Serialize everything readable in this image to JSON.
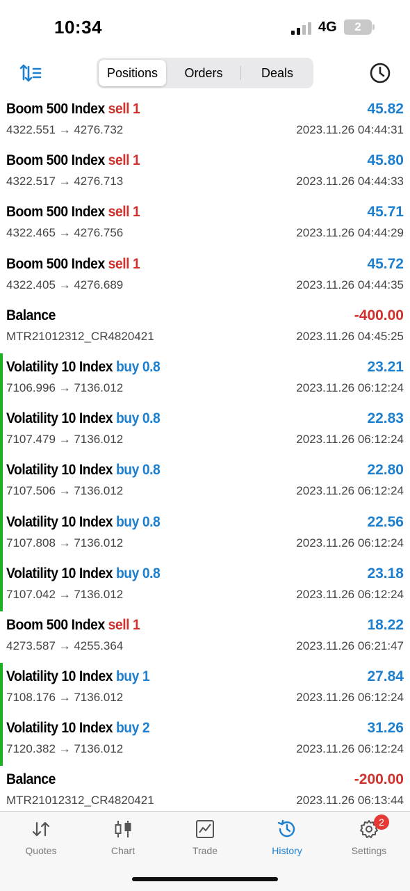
{
  "status": {
    "time": "10:34",
    "network": "4G",
    "battery_text": "2",
    "battery_level": 0.2
  },
  "header": {
    "tabs": [
      {
        "label": "Positions"
      },
      {
        "label": "Orders"
      },
      {
        "label": "Deals"
      }
    ],
    "active_tab": "Positions",
    "icons": {
      "left": "sort-icon",
      "right": "history-clock-icon"
    }
  },
  "rows": [
    {
      "symbol": "Boom 500 Index",
      "side": "sell 1",
      "prices": "4322.551 → 4276.732",
      "profit": "45.82",
      "time": "2023.11.26 04:44:31"
    },
    {
      "symbol": "Boom 500 Index",
      "side": "sell 1",
      "prices": "4322.517 → 4276.713",
      "profit": "45.80",
      "time": "2023.11.26 04:44:33"
    },
    {
      "symbol": "Boom 500 Index",
      "side": "sell 1",
      "prices": "4322.465 → 4276.756",
      "profit": "45.71",
      "time": "2023.11.26 04:44:29"
    },
    {
      "symbol": "Boom 500 Index",
      "side": "sell 1",
      "prices": "4322.405 → 4276.689",
      "profit": "45.72",
      "time": "2023.11.26 04:44:35"
    },
    {
      "symbol": "Balance",
      "side": "",
      "prices": "MTR21012312_CR4820421",
      "profit": "-400.00",
      "time": "2023.11.26 04:45:25"
    },
    {
      "symbol": "Volatility 10 Index",
      "side": "buy 0.8",
      "prices": "7106.996 → 7136.012",
      "profit": "23.21",
      "time": "2023.11.26 06:12:24"
    },
    {
      "symbol": "Volatility 10 Index",
      "side": "buy 0.8",
      "prices": "7107.479 → 7136.012",
      "profit": "22.83",
      "time": "2023.11.26 06:12:24"
    },
    {
      "symbol": "Volatility 10 Index",
      "side": "buy 0.8",
      "prices": "7107.506 → 7136.012",
      "profit": "22.80",
      "time": "2023.11.26 06:12:24"
    },
    {
      "symbol": "Volatility 10 Index",
      "side": "buy 0.8",
      "prices": "7107.808 → 7136.012",
      "profit": "22.56",
      "time": "2023.11.26 06:12:24"
    },
    {
      "symbol": "Volatility 10 Index",
      "side": "buy 0.8",
      "prices": "7107.042 → 7136.012",
      "profit": "23.18",
      "time": "2023.11.26 06:12:24"
    },
    {
      "symbol": "Boom 500 Index",
      "side": "sell 1",
      "prices": "4273.587 → 4255.364",
      "profit": "18.22",
      "time": "2023.11.26 06:21:47"
    },
    {
      "symbol": "Volatility 10 Index",
      "side": "buy 1",
      "prices": "7108.176 → 7136.012",
      "profit": "27.84",
      "time": "2023.11.26 06:12:24"
    },
    {
      "symbol": "Volatility 10 Index",
      "side": "buy 2",
      "prices": "7120.382 → 7136.012",
      "profit": "31.26",
      "time": "2023.11.26 06:12:24"
    },
    {
      "symbol": "Balance",
      "side": "",
      "prices": "MTR21012312_CR4820421",
      "profit": "-200.00",
      "time": "2023.11.26 06:13:44"
    }
  ],
  "colors": {
    "sell": "#d0312d",
    "buy": "#1d7fce",
    "positive": "#1d7fce",
    "negative": "#d0312d",
    "buy_indicator": "#1fb021",
    "active_tab": "#1d7fce"
  },
  "tabbar": {
    "items": [
      {
        "label": "Quotes",
        "icon": "quotes-arrows-icon"
      },
      {
        "label": "Chart",
        "icon": "candlestick-chart-icon"
      },
      {
        "label": "Trade",
        "icon": "trade-chart-icon"
      },
      {
        "label": "History",
        "icon": "history-clock-icon"
      },
      {
        "label": "Settings",
        "icon": "gear-icon",
        "badge": "2"
      }
    ],
    "active": "History"
  }
}
